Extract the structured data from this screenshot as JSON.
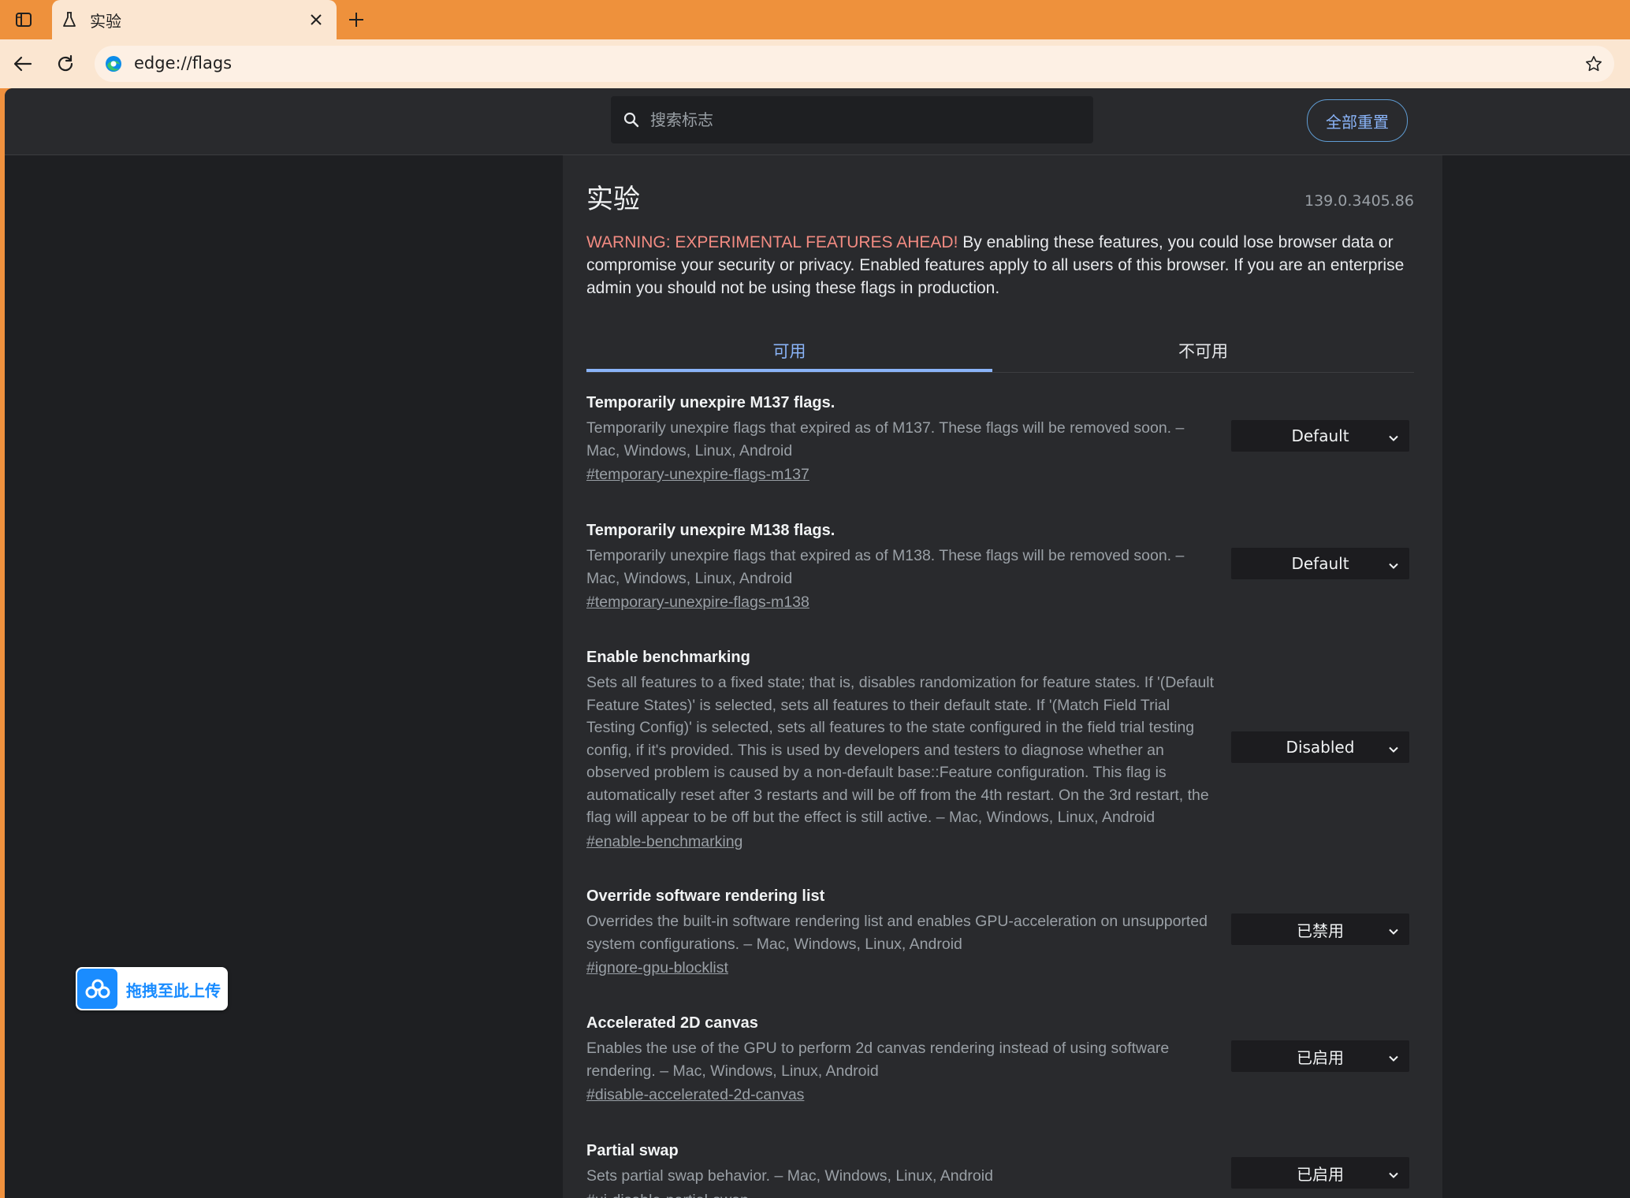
{
  "browser": {
    "tab_title": "实验",
    "url": "edge://flags",
    "colors": {
      "chrome_accent": "#ee913c",
      "chrome_bg": "#fbe6d1"
    }
  },
  "header": {
    "search_placeholder": "搜索标志",
    "reset_label": "全部重置"
  },
  "main": {
    "title": "实验",
    "version": "139.0.3405.86",
    "warning_prefix": "WARNING: EXPERIMENTAL FEATURES AHEAD!",
    "warning_text": " By enabling these features, you could lose browser data or compromise your security or privacy. Enabled features apply to all users of this browser. If you are an enterprise admin you should not be using these flags in production.",
    "tabs": [
      {
        "label": "可用",
        "active": true
      },
      {
        "label": "不可用",
        "active": false
      }
    ],
    "flags": [
      {
        "name": "Temporarily unexpire M137 flags.",
        "description": "Temporarily unexpire flags that expired as of M137. These flags will be removed soon. – Mac, Windows, Linux, Android",
        "link": "#temporary-unexpire-flags-m137",
        "value": "Default"
      },
      {
        "name": "Temporarily unexpire M138 flags.",
        "description": "Temporarily unexpire flags that expired as of M138. These flags will be removed soon. – Mac, Windows, Linux, Android",
        "link": "#temporary-unexpire-flags-m138",
        "value": "Default"
      },
      {
        "name": "Enable benchmarking",
        "description": "Sets all features to a fixed state; that is, disables randomization for feature states. If '(Default Feature States)' is selected, sets all features to their default state. If '(Match Field Trial Testing Config)' is selected, sets all features to the state configured in the field trial testing config, if it's provided. This is used by developers and testers to diagnose whether an observed problem is caused by a non-default base::Feature configuration. This flag is automatically reset after 3 restarts and will be off from the 4th restart. On the 3rd restart, the flag will appear to be off but the effect is still active. – Mac, Windows, Linux, Android",
        "link": "#enable-benchmarking",
        "value": "Disabled"
      },
      {
        "name": "Override software rendering list",
        "description": "Overrides the built-in software rendering list and enables GPU-acceleration on unsupported system configurations. – Mac, Windows, Linux, Android",
        "link": "#ignore-gpu-blocklist",
        "value": "已禁用"
      },
      {
        "name": "Accelerated 2D canvas",
        "description": "Enables the use of the GPU to perform 2d canvas rendering instead of using software rendering. – Mac, Windows, Linux, Android",
        "link": "#disable-accelerated-2d-canvas",
        "value": "已启用"
      },
      {
        "name": "Partial swap",
        "description": "Sets partial swap behavior. – Mac, Windows, Linux, Android",
        "link": "#ui-disable-partial-swap",
        "value": "已启用"
      }
    ]
  },
  "upload_widget": {
    "label": "拖拽至此上传",
    "icon": "cloud-upload-icon"
  }
}
